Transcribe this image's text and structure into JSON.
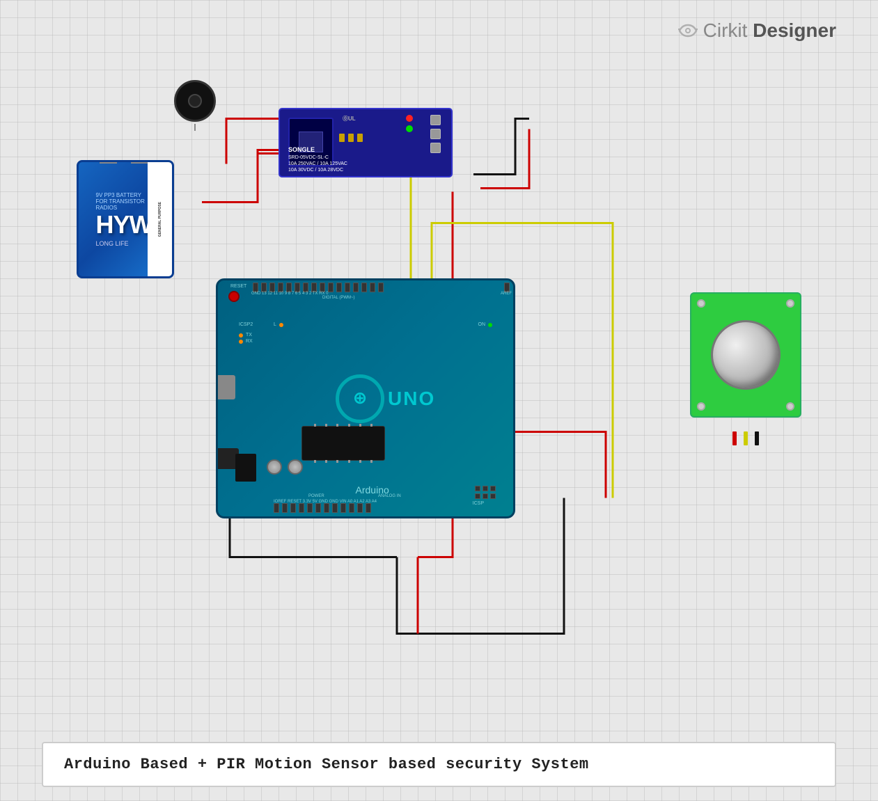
{
  "app": {
    "title": "Cirkit Designer",
    "logo_text": "Cirkit",
    "logo_strong": "Designer"
  },
  "diagram": {
    "title": "Arduino Based + PIR Motion Sensor based security System",
    "components": {
      "buzzer": {
        "label": "Buzzer"
      },
      "relay": {
        "label": "SRD-05VDC-SL-C",
        "brand": "SONGLE"
      },
      "battery": {
        "label": "HYW",
        "sub": "9V BATTERY\nGENERAL PURPOSE\nFOR TRANSISTOR RADIOS\nLONG LIFE"
      },
      "arduino": {
        "label": "Arduino",
        "model": "UNO"
      },
      "pir": {
        "label": "PIR Motion Sensor"
      }
    }
  }
}
